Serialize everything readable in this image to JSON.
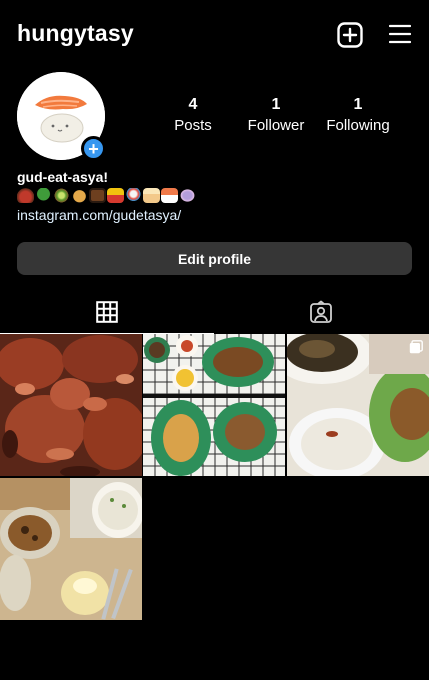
{
  "header": {
    "username": "hungytasy",
    "icons": {
      "new_post": "plus-square-icon",
      "menu": "hamburger-menu-icon"
    }
  },
  "profile": {
    "stats": {
      "posts": {
        "value": "4",
        "label": "Posts"
      },
      "followers": {
        "value": "1",
        "label": "Follower"
      },
      "following": {
        "value": "1",
        "label": "Following"
      }
    },
    "name": "gud-eat-asya!",
    "bio_emojis": [
      "stew-pot",
      "broccoli",
      "kiwi",
      "pie",
      "bento",
      "fries",
      "lollipop",
      "cake",
      "sushi",
      "candy"
    ],
    "link": "instagram.com/gudetasya/",
    "edit_button": "Edit profile"
  },
  "tabs": [
    {
      "name": "grid",
      "icon": "grid-icon",
      "active": true
    },
    {
      "name": "tagged",
      "icon": "tagged-person-icon",
      "active": false
    }
  ],
  "posts": [
    {
      "subject": "fried chicken",
      "multiple": false
    },
    {
      "subject": "nasi campur spread",
      "multiple": false
    },
    {
      "subject": "rice with fried noodles",
      "multiple": true
    },
    {
      "subject": "cookie and dessert",
      "multiple": false
    }
  ],
  "colors": {
    "background": "#000000",
    "button": "#363636",
    "accent": "#3797f0"
  }
}
